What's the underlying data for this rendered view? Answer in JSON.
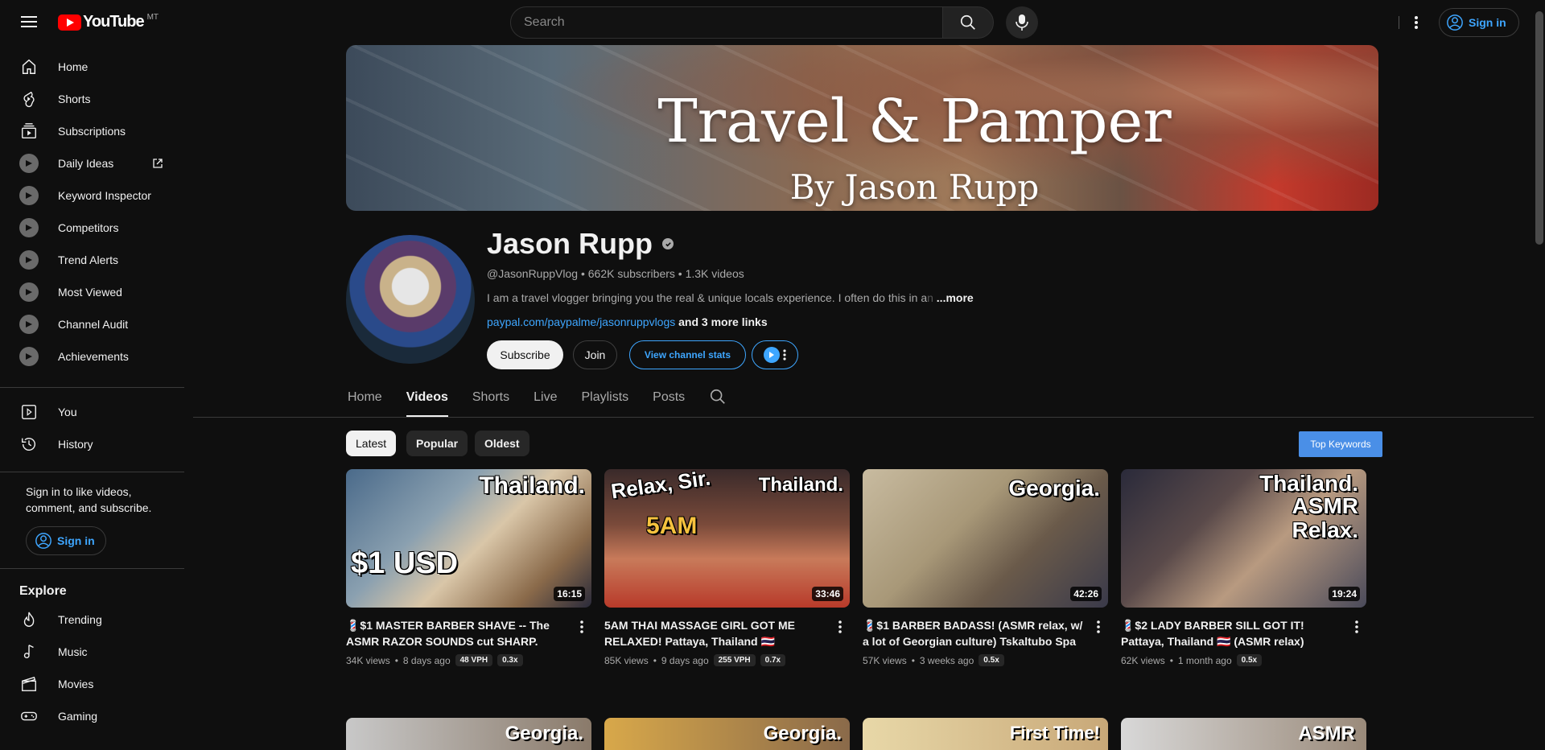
{
  "topbar": {
    "logo_text": "YouTube",
    "region": "MT",
    "search_placeholder": "Search",
    "signin_label": "Sign in"
  },
  "sidebar": {
    "items": [
      {
        "label": "Home",
        "icon": "home-icon"
      },
      {
        "label": "Shorts",
        "icon": "shorts-icon"
      },
      {
        "label": "Subscriptions",
        "icon": "subscriptions-icon"
      },
      {
        "label": "Daily Ideas",
        "icon": "extension-icon"
      },
      {
        "label": "Keyword Inspector",
        "icon": "extension-icon"
      },
      {
        "label": "Competitors",
        "icon": "extension-icon"
      },
      {
        "label": "Trend Alerts",
        "icon": "extension-icon"
      },
      {
        "label": "Most Viewed",
        "icon": "extension-icon"
      },
      {
        "label": "Channel Audit",
        "icon": "extension-icon"
      },
      {
        "label": "Achievements",
        "icon": "extension-icon"
      }
    ],
    "you": [
      {
        "label": "You",
        "icon": "you-icon"
      },
      {
        "label": "History",
        "icon": "history-icon"
      }
    ],
    "signin_prompt": "Sign in to like videos, comment, and subscribe.",
    "signin_label": "Sign in",
    "explore_heading": "Explore",
    "explore": [
      {
        "label": "Trending",
        "icon": "trending-icon"
      },
      {
        "label": "Music",
        "icon": "music-icon"
      },
      {
        "label": "Movies",
        "icon": "movies-icon"
      },
      {
        "label": "Gaming",
        "icon": "gaming-icon"
      }
    ]
  },
  "banner": {
    "title": "Travel & Pamper",
    "subtitle": "By Jason Rupp"
  },
  "channel": {
    "name": "Jason Rupp",
    "meta": "@JasonRuppVlog • 662K subscribers • 1.3K videos",
    "description": "I am a travel vlogger bringing you the real & unique locals experience.  I often do this in a",
    "description_fade": "n",
    "more": "...more",
    "link": "paypal.com/paypalme/jasonruppvlogs",
    "more_links": "and 3 more links",
    "subscribe_label": "Subscribe",
    "join_label": "Join",
    "stats_label": "View channel stats"
  },
  "tabs": [
    "Home",
    "Videos",
    "Shorts",
    "Live",
    "Playlists",
    "Posts"
  ],
  "active_tab": "Videos",
  "chips": [
    "Latest",
    "Popular",
    "Oldest"
  ],
  "top_keywords_label": "Top Keywords",
  "videos": [
    {
      "thumb_text_1": "Thailand.",
      "thumb_text_2": "$1 USD",
      "duration": "16:15",
      "title": "💈$1 MASTER BARBER SHAVE -- The ASMR RAZOR SOUNDS cut SHARP. (ASMR relax g...",
      "views": "34K views",
      "age": "8 days ago",
      "vph": "48 VPH",
      "ratio": "0.3x"
    },
    {
      "thumb_text_1": "Relax, Sir.",
      "thumb_text_2": "Thailand.",
      "thumb_text_3": "5AM",
      "duration": "33:46",
      "title": "5AM THAI MASSAGE GIRL GOT ME RELAXED! Pattaya, Thailand 🇹🇭",
      "views": "85K views",
      "age": "9 days ago",
      "vph": "255 VPH",
      "ratio": "0.7x"
    },
    {
      "thumb_text_1": "Georgia.",
      "duration": "42:26",
      "title": "💈$1 BARBER BADASS! (ASMR relax, w/ a lot of Georgian culture) Tskaltubo Spa Town 🇬🇪",
      "views": "57K views",
      "age": "3 weeks ago",
      "ratio": "0.5x"
    },
    {
      "thumb_text_1": "Thailand.",
      "thumb_text_2": "ASMR",
      "thumb_text_3": "Relax.",
      "duration": "19:24",
      "title": "💈$2 LADY BARBER SILL GOT IT! Pattaya, Thailand 🇹🇭 (ASMR relax)",
      "views": "62K views",
      "age": "1 month ago",
      "ratio": "0.5x"
    }
  ],
  "row2": [
    {
      "thumb_text": "Georgia."
    },
    {
      "thumb_text": "Georgia."
    },
    {
      "thumb_text": "First Time!"
    },
    {
      "thumb_text": "ASMR"
    }
  ]
}
